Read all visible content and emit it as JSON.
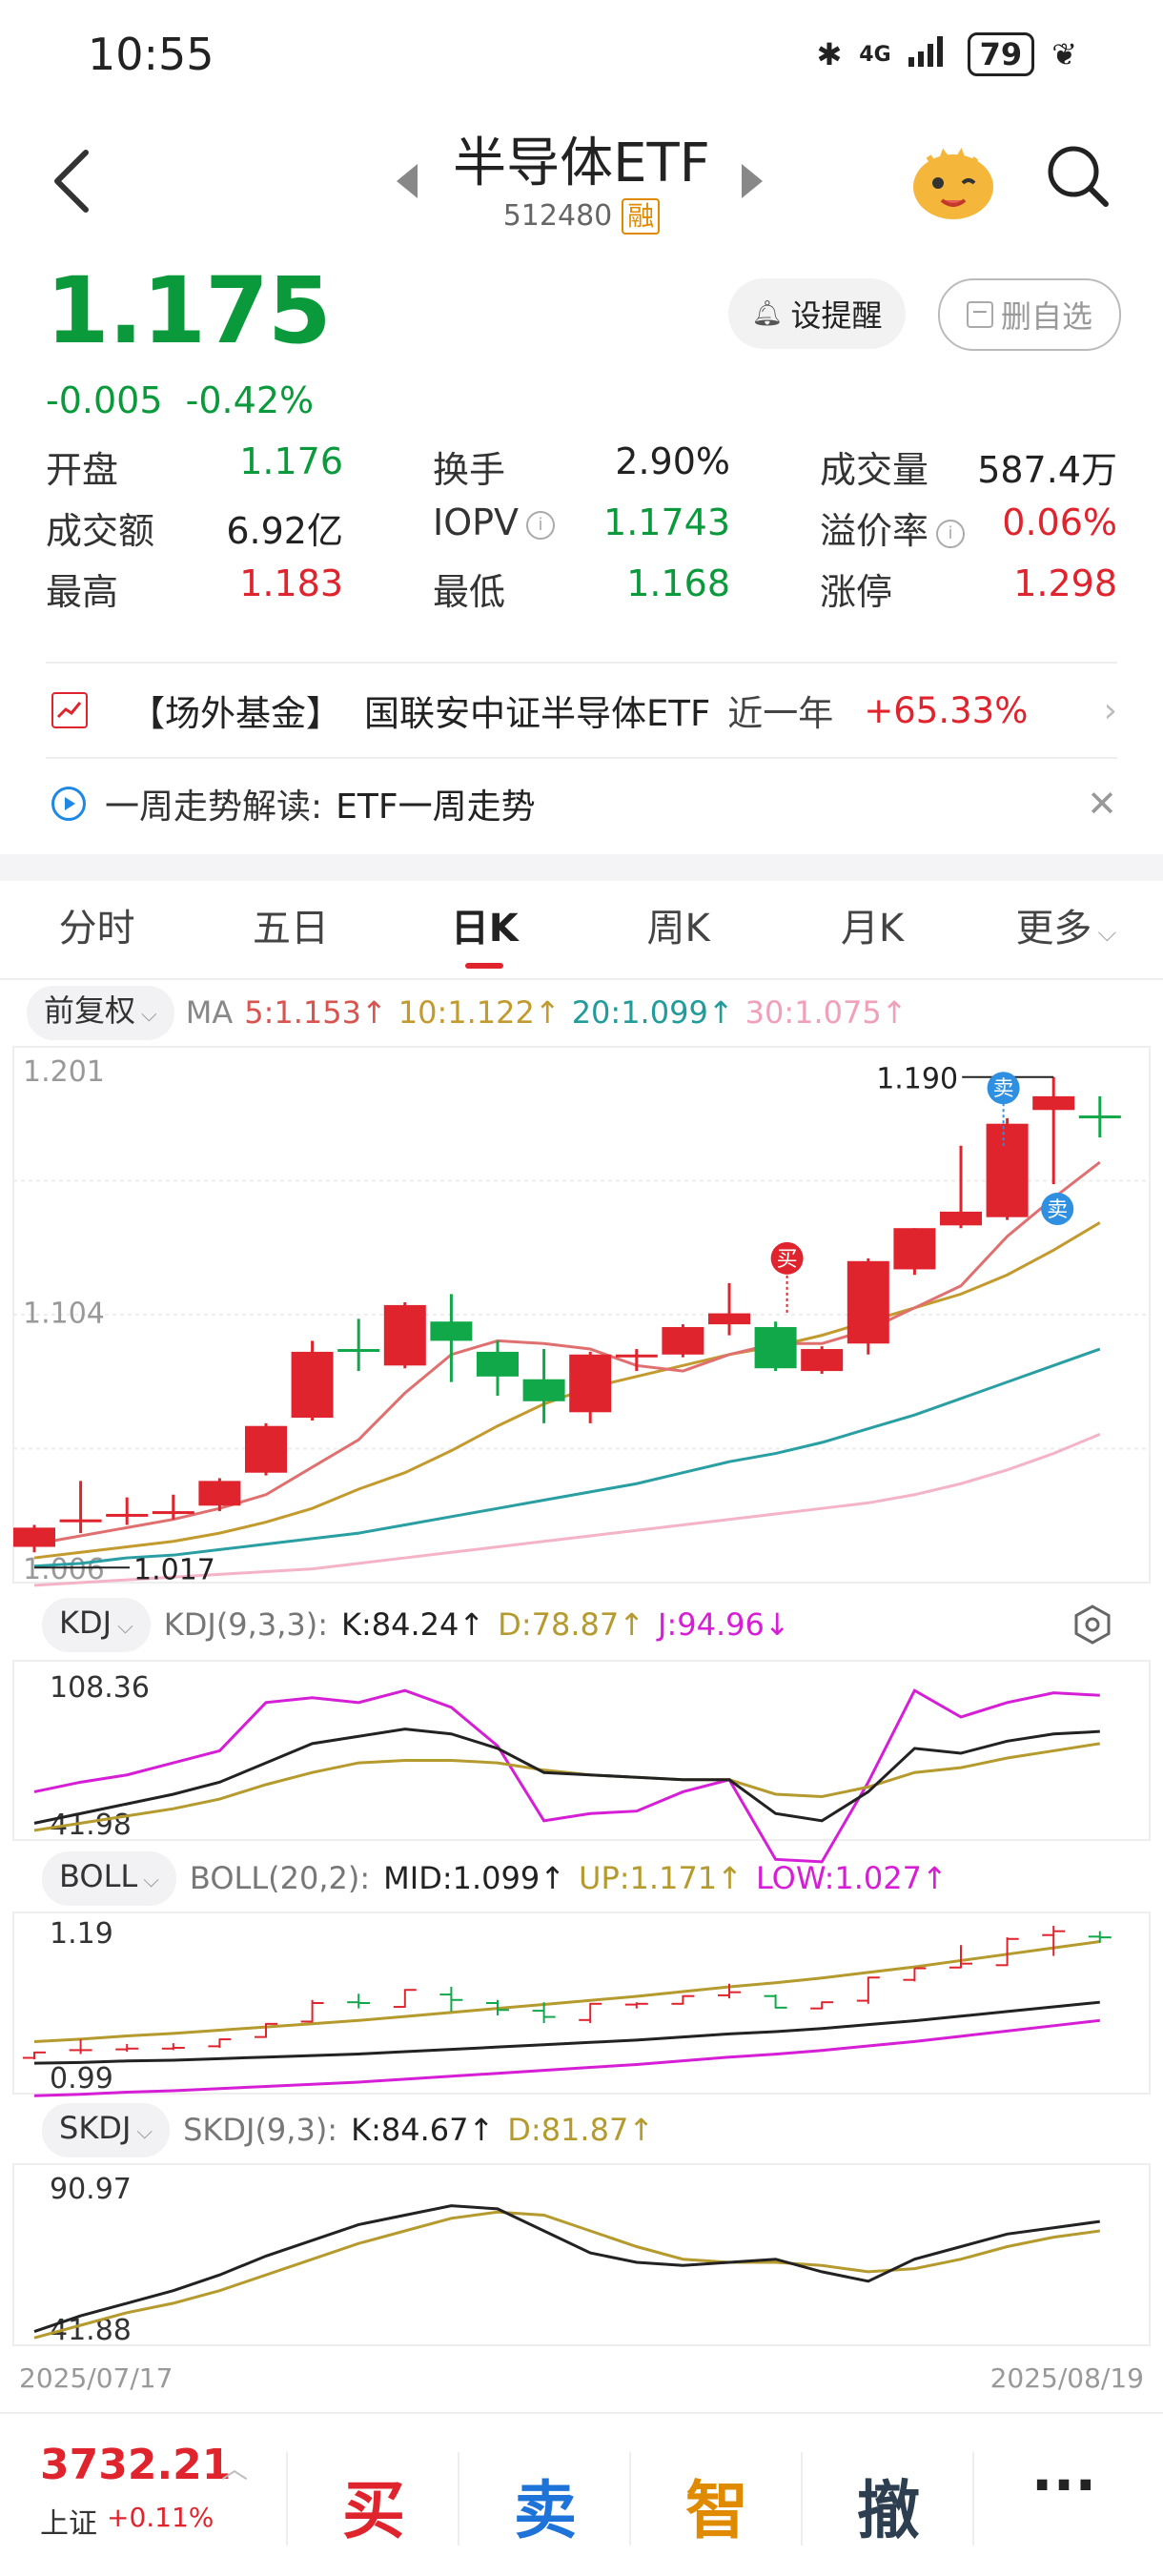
{
  "status_bar": {
    "time": "10:55",
    "network": "4G",
    "battery": "79"
  },
  "header": {
    "title": "半导体ETF",
    "code": "512480",
    "margin_badge": "融"
  },
  "quote": {
    "price": "1.175",
    "change": "-0.005",
    "change_pct": "-0.42%",
    "alert_label": "设提醒",
    "remove_label": "删自选"
  },
  "stats": [
    {
      "label": "开盘",
      "value": "1.176",
      "color": "green"
    },
    {
      "label": "换手",
      "value": "2.90%",
      "color": "black"
    },
    {
      "label": "成交量",
      "value": "587.4万",
      "color": "black"
    },
    {
      "label": "成交额",
      "value": "6.92亿",
      "color": "black"
    },
    {
      "label": "IOPV",
      "value": "1.1743",
      "color": "green"
    },
    {
      "label": "溢价率",
      "value": "0.06%",
      "color": "red"
    },
    {
      "label": "最高",
      "value": "1.183",
      "color": "red"
    },
    {
      "label": "最低",
      "value": "1.168",
      "color": "green"
    },
    {
      "label": "涨停",
      "value": "1.298",
      "color": "red"
    }
  ],
  "fund_row": {
    "tag": "【场外基金】",
    "name": "国联安中证半导体ETF",
    "period": "近一年",
    "value": "+65.33%"
  },
  "trend_row": {
    "label": "一周走势解读:",
    "text": "ETF一周走势"
  },
  "tabs": [
    "分时",
    "五日",
    "日K",
    "周K",
    "月K",
    "更多"
  ],
  "active_tab": "日K",
  "ma": {
    "adjust": "前复权",
    "label": "MA",
    "ma5": "5:1.153↑",
    "ma10": "10:1.122↑",
    "ma20": "20:1.099↑",
    "ma30": "30:1.075↑"
  },
  "chart_data": {
    "type": "candlestick",
    "price_axis": {
      "top": "1.201",
      "mid": "1.104",
      "bottom": "1.006"
    },
    "annotations": {
      "high": "1.190",
      "low": "1.017",
      "buy": "买",
      "sell": "卖"
    },
    "date_start": "2025/07/17",
    "date_end": "2025/08/19",
    "candles": [
      {
        "o": 1.019,
        "c": 1.026,
        "h": 1.027,
        "l": 1.017
      },
      {
        "o": 1.029,
        "c": 1.029,
        "h": 1.043,
        "l": 1.024
      },
      {
        "o": 1.03,
        "c": 1.031,
        "h": 1.037,
        "l": 1.027
      },
      {
        "o": 1.031,
        "c": 1.032,
        "h": 1.038,
        "l": 1.029
      },
      {
        "o": 1.034,
        "c": 1.043,
        "h": 1.044,
        "l": 1.032
      },
      {
        "o": 1.046,
        "c": 1.063,
        "h": 1.064,
        "l": 1.045
      },
      {
        "o": 1.066,
        "c": 1.09,
        "h": 1.094,
        "l": 1.065
      },
      {
        "o": 1.091,
        "c": 1.09,
        "h": 1.102,
        "l": 1.083
      },
      {
        "o": 1.085,
        "c": 1.107,
        "h": 1.108,
        "l": 1.084
      },
      {
        "o": 1.101,
        "c": 1.094,
        "h": 1.111,
        "l": 1.079
      },
      {
        "o": 1.09,
        "c": 1.081,
        "h": 1.094,
        "l": 1.074
      },
      {
        "o": 1.08,
        "c": 1.072,
        "h": 1.091,
        "l": 1.064
      },
      {
        "o": 1.068,
        "c": 1.089,
        "h": 1.09,
        "l": 1.064
      },
      {
        "o": 1.088,
        "c": 1.089,
        "h": 1.091,
        "l": 1.083
      },
      {
        "o": 1.089,
        "c": 1.099,
        "h": 1.1,
        "l": 1.088
      },
      {
        "o": 1.1,
        "c": 1.104,
        "h": 1.115,
        "l": 1.096
      },
      {
        "o": 1.099,
        "c": 1.084,
        "h": 1.101,
        "l": 1.083
      },
      {
        "o": 1.083,
        "c": 1.091,
        "h": 1.092,
        "l": 1.082
      },
      {
        "o": 1.093,
        "c": 1.123,
        "h": 1.124,
        "l": 1.089
      },
      {
        "o": 1.12,
        "c": 1.135,
        "h": 1.135,
        "l": 1.118
      },
      {
        "o": 1.136,
        "c": 1.141,
        "h": 1.165,
        "l": 1.135
      },
      {
        "o": 1.139,
        "c": 1.173,
        "h": 1.175,
        "l": 1.138
      },
      {
        "o": 1.178,
        "c": 1.183,
        "h": 1.19,
        "l": 1.151
      },
      {
        "o": 1.176,
        "c": 1.175,
        "h": 1.183,
        "l": 1.168
      }
    ],
    "ma5": [
      1.02,
      1.023,
      1.026,
      1.029,
      1.033,
      1.038,
      1.048,
      1.058,
      1.075,
      1.089,
      1.094,
      1.093,
      1.091,
      1.085,
      1.083,
      1.089,
      1.093,
      1.093,
      1.098,
      1.106,
      1.114,
      1.132,
      1.146,
      1.159
    ],
    "ma10": [
      1.015,
      1.017,
      1.019,
      1.021,
      1.024,
      1.028,
      1.033,
      1.04,
      1.046,
      1.054,
      1.063,
      1.071,
      1.077,
      1.081,
      1.085,
      1.089,
      1.092,
      1.096,
      1.101,
      1.106,
      1.111,
      1.118,
      1.127,
      1.137
    ],
    "ma20": [
      1.012,
      1.013,
      1.015,
      1.016,
      1.018,
      1.02,
      1.022,
      1.024,
      1.027,
      1.03,
      1.033,
      1.036,
      1.039,
      1.042,
      1.046,
      1.05,
      1.053,
      1.057,
      1.062,
      1.067,
      1.073,
      1.079,
      1.085,
      1.091
    ],
    "ma30": [
      1.005,
      1.006,
      1.007,
      1.008,
      1.009,
      1.01,
      1.011,
      1.013,
      1.015,
      1.017,
      1.019,
      1.021,
      1.023,
      1.025,
      1.027,
      1.029,
      1.031,
      1.033,
      1.035,
      1.038,
      1.042,
      1.047,
      1.053,
      1.06
    ],
    "kdj": {
      "params": "KDJ(9,3,3):",
      "k_label": "K:84.24↑",
      "d_label": "D:78.87↑",
      "j_label": "J:94.96↓",
      "axis_top": "108.36",
      "axis_bottom": "41.98",
      "k": [
        45,
        49,
        53,
        57,
        62,
        70,
        78,
        81,
        84,
        82,
        76,
        66,
        65,
        64,
        63,
        63,
        49,
        46,
        58,
        76,
        74,
        79,
        82,
        83
      ],
      "d": [
        42,
        45,
        48,
        51,
        55,
        61,
        66,
        70,
        71,
        71,
        70,
        67,
        65,
        64,
        63,
        63,
        57,
        56,
        60,
        66,
        68,
        72,
        75,
        78
      ],
      "j": [
        58,
        62,
        65,
        70,
        75,
        95,
        97,
        95,
        100,
        93,
        77,
        46,
        49,
        50,
        58,
        63,
        30,
        29,
        62,
        100,
        89,
        95,
        99,
        98
      ]
    },
    "boll": {
      "params": "BOLL(20,2):",
      "mid_label": "MID:1.099↑",
      "up_label": "UP:1.171↑",
      "low_label": "LOW:1.027↑",
      "axis_top": "1.19",
      "axis_bottom": "0.99"
    },
    "skdj": {
      "params": "SKDJ(9,3):",
      "k_label": "K:84.67↑",
      "d_label": "D:81.87↑",
      "axis_top": "90.97",
      "axis_bottom": "41.88",
      "k": [
        42,
        47,
        51,
        55,
        60,
        66,
        71,
        76,
        79,
        82,
        81,
        74,
        67,
        64,
        63,
        64,
        65,
        61,
        58,
        65,
        69,
        73,
        75,
        77
      ],
      "d": [
        40,
        44,
        48,
        51,
        55,
        60,
        65,
        70,
        74,
        78,
        80,
        79,
        74,
        69,
        65,
        64,
        64,
        63,
        61,
        62,
        65,
        69,
        72,
        74
      ]
    }
  },
  "indicator_pills": {
    "kdj": "KDJ",
    "boll": "BOLL",
    "skdj": "SKDJ"
  },
  "bottom_bar": {
    "index_value": "3732.21",
    "index_name": "上证",
    "index_change": "+0.11%",
    "buy": "买",
    "sell": "卖",
    "smart": "智",
    "cancel": "撤",
    "more": "···"
  }
}
